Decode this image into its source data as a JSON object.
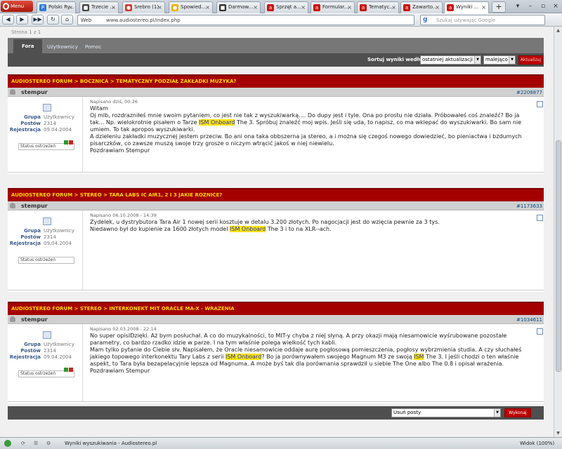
{
  "browser": {
    "menu_label": "Menu",
    "tabs": [
      {
        "label": "Polski Ry...",
        "color": "#2f7bd6",
        "glyph": "P"
      },
      {
        "label": "Trzecie ...",
        "color": "#444444",
        "glyph": "■"
      },
      {
        "label": "Srebro (1)",
        "color": "#d33b2b",
        "glyph": "●"
      },
      {
        "label": "Spowied...",
        "color": "#f0b400",
        "glyph": "●"
      },
      {
        "label": "Darmow...",
        "color": "#333333",
        "glyph": "■"
      },
      {
        "label": "Sprzęt a...",
        "color": "#cc1111",
        "glyph": "a"
      },
      {
        "label": "Formular...",
        "color": "#cc1111",
        "glyph": "a"
      },
      {
        "label": "Tematyc...",
        "color": "#cc1111",
        "glyph": "a"
      },
      {
        "label": "Zawarto...",
        "color": "#cc1111",
        "glyph": "a"
      },
      {
        "label": "Wyniki ...",
        "color": "#cc1111",
        "glyph": "a"
      }
    ],
    "address_prefix": "Web",
    "url": "www.audiostereo.pl/index.php",
    "search_placeholder": "Szukaj używając Google",
    "status_text": "Wyniki wyszukiwania - Audiostereo.pl",
    "zoom": "Widok (100%)"
  },
  "forum": {
    "page_count": "Strona 1 z 1",
    "nav_tabs": [
      "Fora",
      "Użytkownicy",
      "Pomoc"
    ],
    "sort_label": "Sortuj wyniki według",
    "sort_value": "ostatniej aktualizacji",
    "order_value": "malejąco",
    "sort_button": "Aktualizuj",
    "moderation_select": "Usuń posty",
    "moderation_button": "Wykonaj"
  },
  "posts": [
    {
      "title": "AUDIOSTEREO FORUM > BOCZNICA > TEMATYCZNY PODZIAŁ ZAKŁADKI MUZYKA?",
      "user": "stempur",
      "number": "#2208877",
      "group_label": "Grupa",
      "group": "Użytkownicy",
      "posts_label": "Postów",
      "posts": "2314",
      "reg_label": "Rejestracja",
      "registered": "09.04.2004",
      "status_label": "Status ostrzeżeń",
      "date": "Napisano dziś, 00:26",
      "l1": "Witam",
      "l2a": "Oj mlb, rozdrazniłeś mnie swoim pytaniem, co jest nie tak z wyszukiwarką.... Do dupy jest i tyle. Ona po prostu nie działa. Próbowałeś coś znaleźć? Bo ja tak... Np. wielokrotnie pisałem o Tarze ",
      "hl1": "ISM",
      "sp1": " ",
      "hl2": "Onboard",
      "l2b": " The 3. Spróbuj znaleźć moj wpis. Jeśli się uda, to napisz, co ma wklepać do wyszukiwarki. Bo sam nie umiem. To tak apropos wyszukiwarki.",
      "l3": "A dzieleniu zakładki muzycznej jestem przeciw. Bo ani ona taka obbszerna ja stereo, a i można się czegoś nowego dowiedzieć, bo pieniactwa i bzdumych pisarczków, co zawsze muszą swoje trzy grosze o niczym wtrącić jakoś w niej niewielu.",
      "l4": "Pozdrawiam Stempur"
    },
    {
      "title": "AUDIOSTEREO FORUM > STEREO > TARA LABS IC AIR1, 2 I 3 JAKIE ROZNICE?",
      "user": "stempur",
      "number": "#1173633",
      "group_label": "Grupa",
      "group": "Użytkownicy",
      "posts_label": "Postów",
      "posts": "2314",
      "reg_label": "Rejestracja",
      "registered": "09.04.2004",
      "status_label": "Status ostrzeżeń",
      "date": "Napisano 06.10.2008 - 14:39",
      "l1": "Zydelek, u dystrybutora Tara Air 1 nowej serii kosztuje w detalu 3.200 złotych. Po nagocjacji jest do wzięcia pewnie za 3 tys.",
      "l2a": "Niedawno był do kupienie za 1600 złotych model ",
      "hl1": "ISM",
      "sp1": " ",
      "hl2": "Onboard",
      "l2b": " The 3 i to na XLR--ach."
    },
    {
      "title": "AUDIOSTEREO FORUM > STEREO > INTERKONEKT MIT ORACLE MA-X - WRAZENIA",
      "user": "stempur",
      "number": "#1034611",
      "group_label": "Grupa",
      "group": "Użytkownicy",
      "posts_label": "Postów",
      "posts": "2314",
      "reg_label": "Rejestracja",
      "registered": "09.04.2004",
      "status_label": "Status ostrzeżeń",
      "date": "Napisano 02.03.2008 - 22:14",
      "l1": "No super opisIDzięki. Aż bym posłuchał. A co do muzykalności, to MIT-y chyba z niej słyną. A przy okazji mają niesamowicie wyśrubowane pozostałe parametry, co bardzo rzadko idzie w parze. I na tym właśnie polega wielkość tych kabli.",
      "l2a": "Mam tylko pytanie do Ciebie słv. Napisałem, że Oracle niesamowicie oddaje aurę pogłosową pomieszczenia, pogłosy wybrzmienia studia. A czy słuchałeś jakiego topowego interkonektu Tary Labs z serii ",
      "hl1": "ISM",
      "sp1": " ",
      "hl2": "Onboard",
      "l2b": "? Bo ja porównywałem swojego Magnum M3 ze swoją ",
      "hl3": "ISM",
      "l2c": " The 3. I jeśli chodzi o ten właśnie aspekt, to Tara była bezapelacyjnie lepsza od Magnuma. A może byś tak dla porównania sprawdził u siebie The One albo The 0.8 i opisał wrażenia.",
      "l4": "Pozdrawiam Stempur"
    }
  ]
}
